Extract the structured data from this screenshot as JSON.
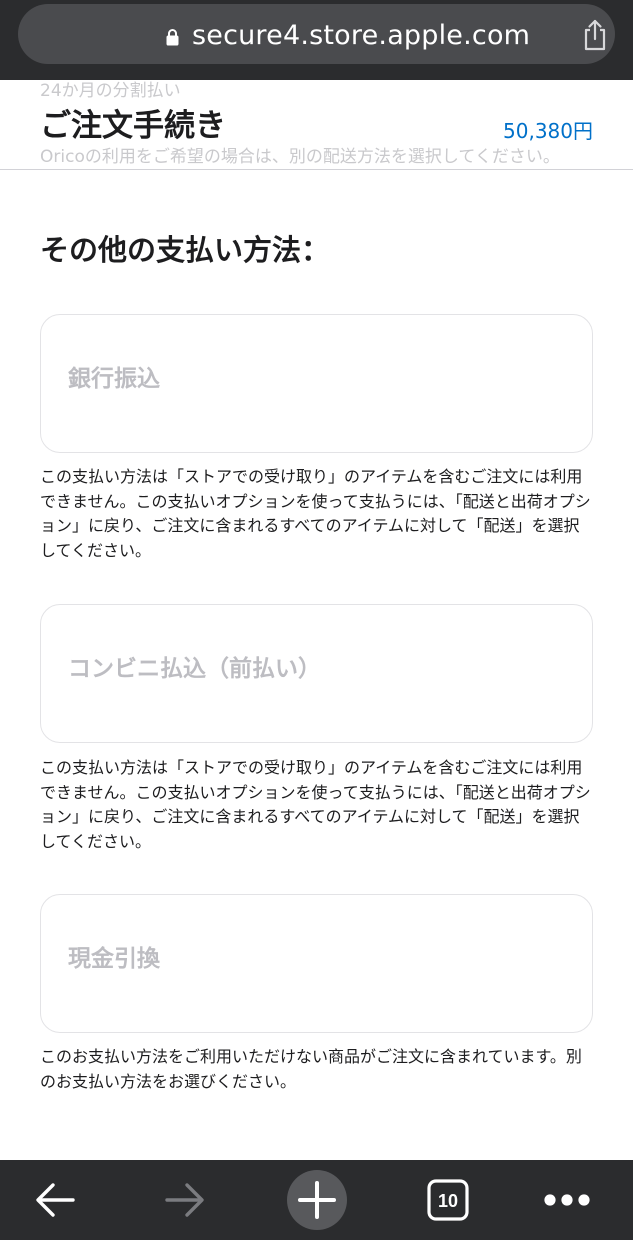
{
  "browser": {
    "url": "secure4.store.apple.com",
    "tab_count": "10",
    "icons": [
      "lock-icon",
      "share-icon",
      "back-arrow-icon",
      "forward-arrow-icon",
      "new-tab-plus-icon",
      "tabs-count-icon",
      "more-dots-icon"
    ]
  },
  "header": {
    "title": "ご注文手続き",
    "total": "50,380円",
    "ghost_line_1": "24か月の分割払い",
    "ghost_line_2": "Oricoの利用をご希望の場合は、別の配送方法を選択してください。"
  },
  "section": {
    "title": "その他の支払い方法："
  },
  "options": [
    {
      "label": "銀行振込",
      "note": "この支払い方法は「ストアでの受け取り」のアイテムを含むご注文には利用できません。この支払いオプションを使って支払うには、「配送と出荷オプション」に戻り、ご注文に含まれるすべてのアイテムに対して「配送」を選択してください。"
    },
    {
      "label": "コンビニ払込（前払い）",
      "note": "この支払い方法は「ストアでの受け取り」のアイテムを含むご注文には利用できません。この支払いオプションを使って支払うには、「配送と出荷オプション」に戻り、ご注文に含まれるすべてのアイテムに対して「配送」を選択してください。"
    },
    {
      "label": "現金引換",
      "note": "このお支払い方法をご利用いただけない商品がご注文に含まれています。別のお支払い方法をお選びください。"
    }
  ],
  "colors": {
    "chrome": "#2b2c2e",
    "urlbar": "#4a4b4e",
    "accent_blue": "#0070c9",
    "disabled_label": "#bdbdc2",
    "card_border": "#e3e3e6"
  }
}
